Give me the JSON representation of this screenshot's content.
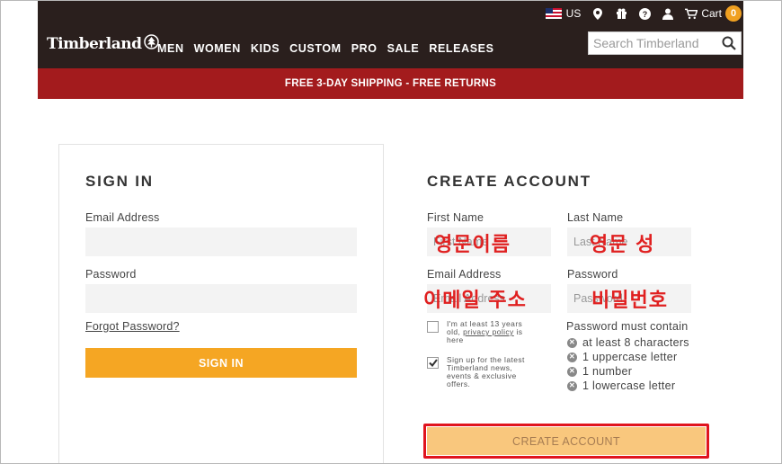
{
  "header": {
    "country": "US",
    "cart_label": "Cart",
    "cart_count": "0",
    "logo_text": "Timberland",
    "nav": [
      "MEN",
      "WOMEN",
      "KIDS",
      "CUSTOM",
      "PRO",
      "SALE",
      "RELEASES"
    ],
    "search_placeholder": "Search Timberland"
  },
  "promo": "FREE  3-DAY SHIPPING - FREE RETURNS",
  "signin": {
    "title": "SIGN IN",
    "email_label": "Email Address",
    "password_label": "Password",
    "forgot": "Forgot Password?",
    "button": "SIGN IN"
  },
  "create": {
    "title": "CREATE ACCOUNT",
    "first_name_label": "First Name",
    "first_name_placeholder": "First Name",
    "last_name_label": "Last Name",
    "last_name_placeholder": "Last Name",
    "email_label": "Email Address",
    "email_placeholder": "Email Address",
    "password_label": "Password",
    "password_placeholder": "Password",
    "age_check": {
      "pre": "I'm at least 13 years old, ",
      "link": "privacy policy",
      "post": " is here",
      "checked": false
    },
    "news_check": {
      "text": "Sign up for the latest Timberland news, events & exclusive offers.",
      "checked": true
    },
    "password_rules_title": "Password must contain",
    "password_rules": [
      "at least 8 characters",
      "1 uppercase letter",
      "1 number",
      "1 lowercase letter"
    ],
    "button": "CREATE ACCOUNT"
  },
  "annotations": {
    "first_name": "영문이름",
    "last_name": "영문 성",
    "email": "이메일 주소",
    "password": "비밀번호",
    "highlight_color": "#e0141e"
  },
  "colors": {
    "header_bg": "#2a1f1d",
    "promo_bg": "#a31b1d",
    "accent": "#f5a623"
  }
}
